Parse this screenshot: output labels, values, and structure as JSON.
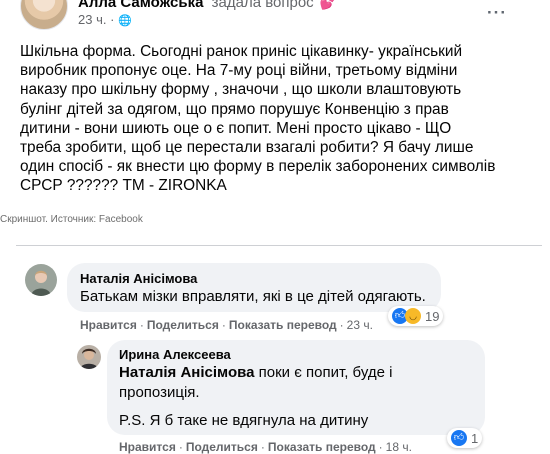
{
  "post": {
    "author": "Алла Саможська",
    "action": "задала вопрос",
    "time": "23 ч.",
    "more": "···",
    "text": "Шкільна форма. Сьогодні ранок приніс цікавинку- український\nвиробник пропонує оце. На 7-му році війни, третьому відміни\nнаказу про шкільну форму , значочи , що школи влаштовують\nбулінг дітей за одягом, що прямо порушує Конвенцію з прав\nдитини - вони шиють оце о є попит. Мені просто цікаво - ЩО\nтреба зробити, щоб це перестали взагалі робити? Я бачу лише\nодин спосіб - як внести цю форму в перелік заборонених символів\nСРСР ?????? ТМ - ZIRONKA"
  },
  "caption": "Скриншот. Источник: Facebook",
  "comments": [
    {
      "author": "Наталія Анісімова",
      "text": "Батькам мізки вправляти, які в це дітей одягають.",
      "actions": {
        "like": "Нравится",
        "reply": "Поделиться",
        "translate": "Показать перевод",
        "time": "23 ч."
      },
      "reactions": {
        "count": "19",
        "icons": [
          "like",
          "haha"
        ]
      }
    },
    {
      "author": "Ирина Алексеева",
      "mention": "Наталія Анісімова",
      "text_after_mention": " поки є попит, буде і\nпропозиція.",
      "text_ps": "P.S. Я б таке не вдягнула на дитину",
      "actions": {
        "like": "Нравится",
        "reply": "Поделиться",
        "translate": "Показать перевод",
        "time": "18 ч."
      },
      "reactions": {
        "count": "1",
        "icons": [
          "like"
        ]
      }
    }
  ],
  "colors": {
    "link": "#385898",
    "secondary": "#65676b",
    "bubble": "#f0f2f5",
    "like": "#1877f2"
  }
}
